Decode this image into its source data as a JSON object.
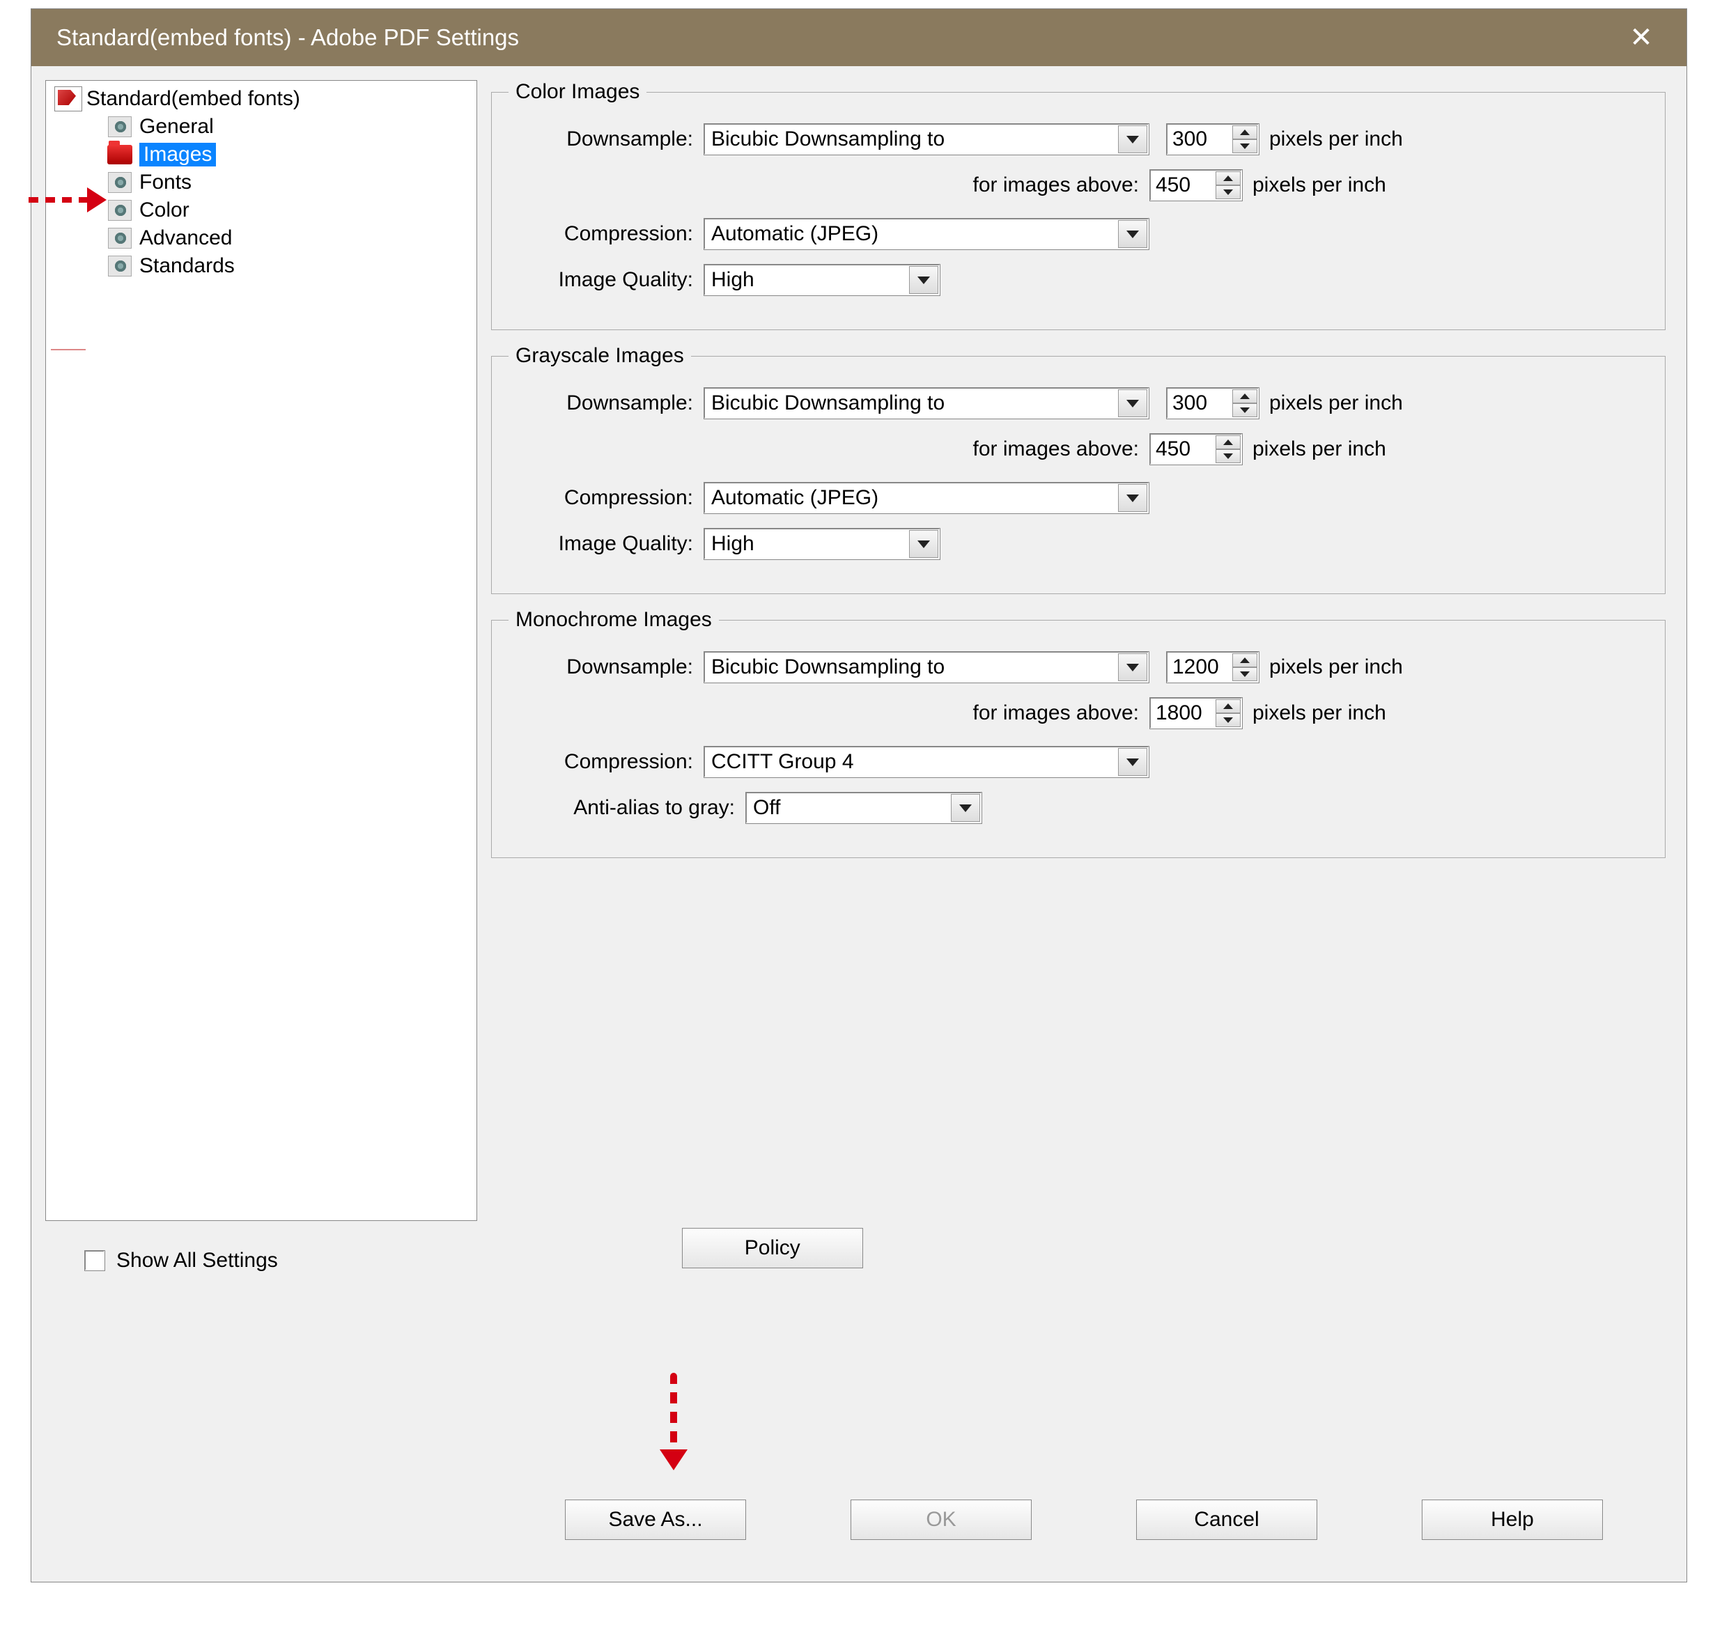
{
  "window": {
    "title": "Standard(embed fonts) - Adobe PDF Settings"
  },
  "tree": {
    "root": "Standard(embed fonts)",
    "items": [
      "General",
      "Images",
      "Fonts",
      "Color",
      "Advanced",
      "Standards"
    ],
    "selected": "Images"
  },
  "color_images": {
    "legend": "Color Images",
    "downsample_label": "Downsample:",
    "downsample_value": "Bicubic Downsampling to",
    "dpi": "300",
    "ppi_label": "pixels per inch",
    "above_label": "for images above:",
    "above_dpi": "450",
    "compression_label": "Compression:",
    "compression_value": "Automatic (JPEG)",
    "quality_label": "Image Quality:",
    "quality_value": "High"
  },
  "grayscale_images": {
    "legend": "Grayscale Images",
    "downsample_label": "Downsample:",
    "downsample_value": "Bicubic Downsampling to",
    "dpi": "300",
    "ppi_label": "pixels per inch",
    "above_label": "for images above:",
    "above_dpi": "450",
    "compression_label": "Compression:",
    "compression_value": "Automatic (JPEG)",
    "quality_label": "Image Quality:",
    "quality_value": "High"
  },
  "monochrome_images": {
    "legend": "Monochrome Images",
    "downsample_label": "Downsample:",
    "downsample_value": "Bicubic Downsampling to",
    "dpi": "1200",
    "ppi_label": "pixels per inch",
    "above_label": "for images above:",
    "above_dpi": "1800",
    "compression_label": "Compression:",
    "compression_value": "CCITT Group 4",
    "antialias_label": "Anti-alias to gray:",
    "antialias_value": "Off"
  },
  "footer": {
    "show_all": "Show All Settings",
    "policy": "Policy",
    "save_as": "Save As...",
    "ok": "OK",
    "cancel": "Cancel",
    "help": "Help"
  }
}
